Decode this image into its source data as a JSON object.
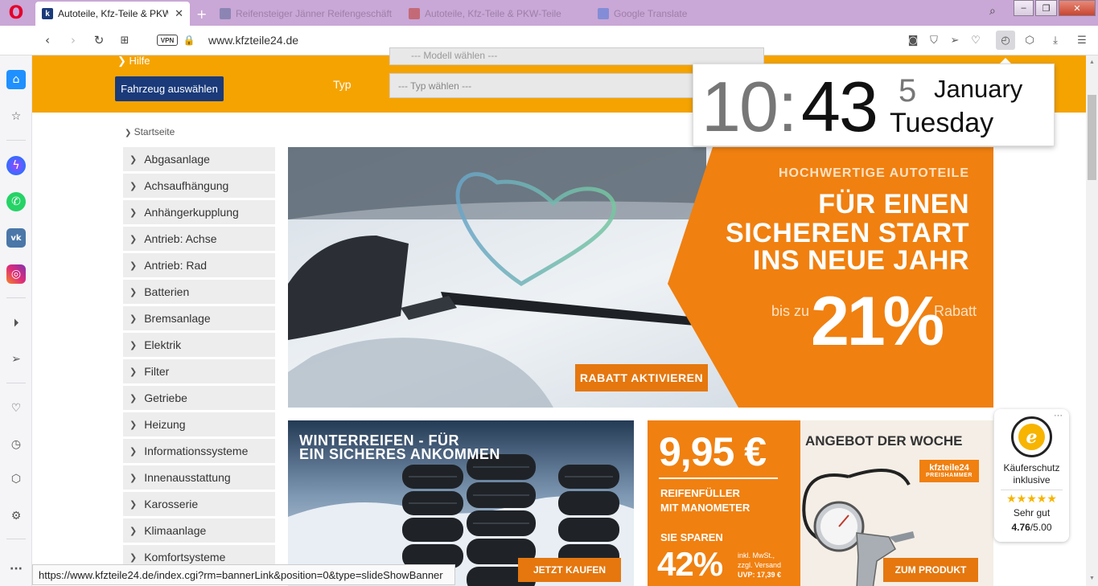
{
  "browser": {
    "tabs": [
      {
        "title": "Autoteile, Kfz-Teile & PKW-",
        "active": true
      },
      {
        "title": "Reifensteiger Jänner Reifengeschäft",
        "active": false
      },
      {
        "title": "Autoteile, Kfz-Teile & PKW-Teile",
        "active": false
      },
      {
        "title": "Google Translate",
        "active": false
      }
    ],
    "url": "www.kfzteile24.de",
    "vpn_label": "VPN",
    "status_url": "https://www.kfzteile24.de/index.cgi?rm=bannerLink&position=0&type=slideShowBanner"
  },
  "clock": {
    "hour": "10",
    "colon": ":",
    "minute": "43",
    "day": "5",
    "month": "January",
    "weekday": "Tuesday"
  },
  "header": {
    "hilfe": "Hilfe",
    "fahrzeug_button": "Fahrzeug auswählen",
    "typ_label": "Typ",
    "modell_placeholder": "--- Modell wählen ---",
    "typ_placeholder": "--- Typ wählen ---"
  },
  "breadcrumb": "Startseite",
  "categories": [
    "Abgasanlage",
    "Achsaufhängung",
    "Anhängerkupplung",
    "Antrieb: Achse",
    "Antrieb: Rad",
    "Batterien",
    "Bremsanlage",
    "Elektrik",
    "Filter",
    "Getriebe",
    "Heizung",
    "Informationssysteme",
    "Innenausstattung",
    "Karosserie",
    "Klimaanlage",
    "Komfortsysteme"
  ],
  "hero": {
    "kicker": "HOCHWERTIGE AUTOTEILE",
    "line1": "FÜR EINEN",
    "line2": "SICHEREN START",
    "line3": "INS NEUE JAHR",
    "bis": "bis zu",
    "percent": "21%",
    "rabatt": "Rabatt",
    "button": "RABATT AKTIVIEREN"
  },
  "winter": {
    "line1": "WINTERREIFEN - FÜR",
    "line2": "EIN SICHERES ANKOMMEN",
    "button": "JETZT KAUFEN"
  },
  "offer": {
    "price": "9,95 €",
    "product1": "REIFENFÜLLER",
    "product2": "MIT MANOMETER",
    "spare": "SIE SPAREN",
    "percent": "42%",
    "small1": "inkl. MwSt.,",
    "small2": "zzgl. Versand",
    "small3": "UVP: 17,39 €",
    "title": "ANGEBOT DER WOCHE",
    "logo_main": "kfzteile24",
    "logo_sub": "PREISHAMMER",
    "button": "ZUM PRODUKT"
  },
  "trusted": {
    "dots": "···",
    "seal_letter": "e",
    "k1": "Käuferschutz",
    "k2": "inklusive",
    "stars": "★★★★★",
    "rating": "Sehr gut",
    "score_main": "4.76",
    "score_rest": "/5.00"
  },
  "colors": {
    "orange_band": "#f5a300",
    "brand_orange": "#e5770e",
    "navy": "#1a3a7a",
    "tabstrip": "#c9a7d6"
  }
}
